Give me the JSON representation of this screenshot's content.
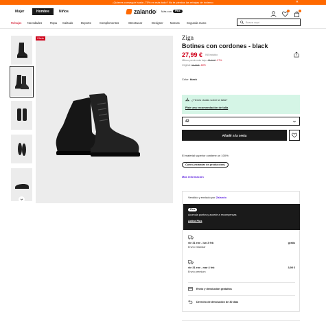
{
  "promo": {
    "text": "¡Quieres conseguir hasta -75% en más todo? No te pierdas las rebajas de invierno",
    "close": "✕"
  },
  "nav": {
    "genders": [
      "Mujer",
      "Hombre",
      "Niños"
    ],
    "active_gender": "Hombre",
    "brand": "zalando",
    "plus_prefix": "Más con",
    "plus_label": "Plus",
    "icons": [
      "user-icon",
      "heart-icon",
      "bag-icon"
    ]
  },
  "categories": [
    {
      "label": "Rebajas",
      "sale": true
    },
    {
      "label": "Novedades"
    },
    {
      "label": "Ropa"
    },
    {
      "label": "Calzado"
    },
    {
      "label": "Deporte"
    },
    {
      "label": "Complementos"
    },
    {
      "label": "Streetwear"
    },
    {
      "label": "Designer"
    },
    {
      "label": "Marcas"
    },
    {
      "label": "Segunda mano"
    }
  ],
  "search": {
    "placeholder": "Busca aquí"
  },
  "gallery": {
    "badge": "Oferta",
    "thumbnail_count": 5,
    "selected_index": 1
  },
  "product": {
    "brand": "Zign",
    "title": "Botines con cordones - black",
    "price": "27,99 €",
    "vat": "IVA incluido",
    "lowest_label": "Último precio más bajo:",
    "lowest_price": "28,49 €",
    "lowest_discount": "-27%",
    "original_label": "Original:",
    "original_price": "69,99 €",
    "original_discount": "-60%",
    "color_label": "Color:",
    "color_value": "black"
  },
  "size_help": {
    "question": "¿Tienes dudas sobre la talla?",
    "link": "Pide una recomendación de talla"
  },
  "size_select": {
    "value": "42"
  },
  "cart": {
    "add_label": "Añadir a la cesta"
  },
  "material": {
    "text": "El material superior contiene un 100%:",
    "tag": "Cuero (estándar de producción)",
    "more": "Más información"
  },
  "shipping": {
    "sold_by_prefix": "Vendido y enviado por",
    "sold_by": "Zalando",
    "plus": {
      "pill": "Plus",
      "text": "Acumula puntos y accede a recompensas",
      "action": "Activa Plus"
    },
    "options": [
      {
        "dates": "vie 31 ene - lun 3 feb",
        "price": "gratis",
        "type": "Envío estándar"
      },
      {
        "dates": "vie 31 ene - mar 4 feb",
        "price": "3,95 €",
        "type": "Envío premium"
      }
    ],
    "features": [
      "Envío y devolución gratuitos",
      "Derecho de devolución de 30 días"
    ]
  },
  "colors": {
    "accent": "#ff6900",
    "sale": "#d0021b",
    "link": "#6328e0",
    "help_bg": "#d5f5e6"
  }
}
